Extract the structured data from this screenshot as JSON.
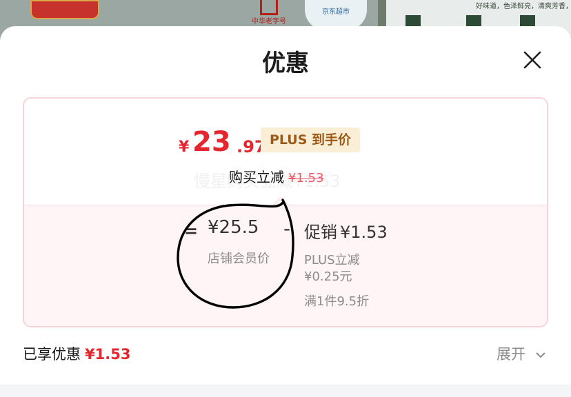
{
  "background": {
    "badge1": "中华老字号",
    "badge2": "京东超市",
    "right_text": "好味道，色泽鲜亮，清爽芳香，入喉回甘"
  },
  "sheet": {
    "title": "优惠",
    "close_icon": "close-icon"
  },
  "card": {
    "price_currency": "¥",
    "price_int": "23",
    "price_dec": ".97",
    "plus_tag": "PLUS 到手价",
    "ghost_text": "慢星购买立减¥1.53",
    "reduce_label": "购买立减",
    "reduce_value": "¥1.53",
    "eq": "=",
    "member_price": "¥25.5",
    "member_label": "店铺会员价",
    "minus": "-",
    "promo_label": "促销",
    "promo_value": "¥1.53",
    "promo_sub1": "PLUS立减",
    "promo_sub2": "¥0.25元",
    "promo_sub3": "满1件9.5折"
  },
  "summary": {
    "label": "已享优惠",
    "value": "¥1.53",
    "expand_label": "展开",
    "expand_icon": "chevron-down-icon"
  },
  "colors": {
    "accent_red": "#e4262f",
    "plus_gold": "#9c5a16",
    "card_border": "#f6d3d8"
  }
}
